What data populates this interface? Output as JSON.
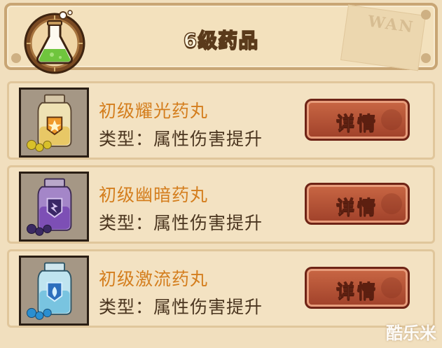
{
  "header": {
    "title": "6级药品",
    "emblem_icon": "flask-icon",
    "watermark": "WAN"
  },
  "items": [
    {
      "name": "初级耀光药丸",
      "type_label": "类型：属性伤害提升",
      "button_label": "详情",
      "icon": "potion-bottle-icon",
      "liquid_color": "#e8c866",
      "badge_color": "#f09a2a",
      "pill_color": "#d8c02a"
    },
    {
      "name": "初级幽暗药丸",
      "type_label": "类型：属性伤害提升",
      "button_label": "详情",
      "icon": "potion-bottle-icon",
      "liquid_color": "#7d4fb5",
      "badge_color": "#3a2766",
      "pill_color": "#3b2a63"
    },
    {
      "name": "初级激流药丸",
      "type_label": "类型：属性伤害提升",
      "button_label": "详情",
      "icon": "potion-bottle-icon",
      "liquid_color": "#79c4e0",
      "badge_color": "#2d6fbd",
      "pill_color": "#2b8fd0"
    }
  ],
  "footer_watermark": "酷乐米"
}
